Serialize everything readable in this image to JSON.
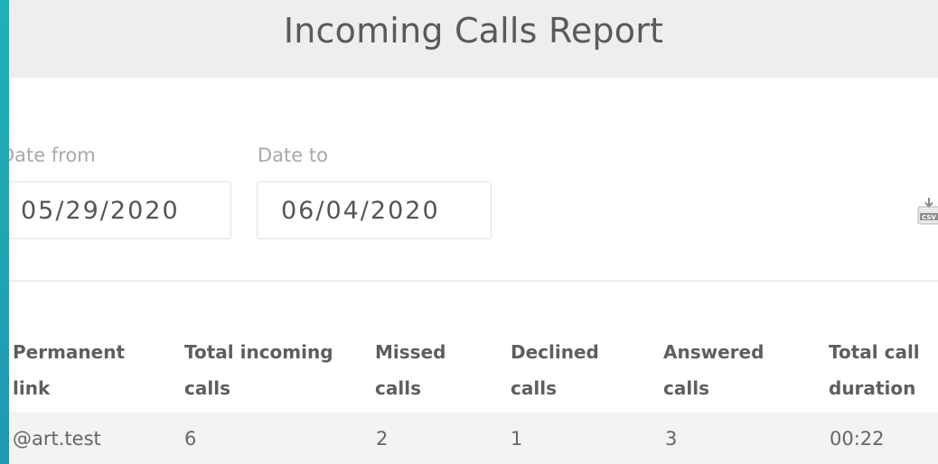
{
  "report": {
    "title": "Incoming Calls Report"
  },
  "filters": {
    "date_from_label": "Date from",
    "date_from_value": "05/29/2020",
    "date_to_label": "Date to",
    "date_to_value": "06/04/2020",
    "export_icon": "csv-download-icon"
  },
  "table": {
    "headers": [
      [
        "Permanent",
        "link"
      ],
      [
        "Total incoming",
        "calls"
      ],
      [
        "Missed",
        "calls"
      ],
      [
        "Declined",
        "calls"
      ],
      [
        "Answered",
        "calls"
      ],
      [
        "Total call",
        "duration"
      ]
    ],
    "rows": [
      [
        "@art.test",
        "6",
        "2",
        "1",
        "3",
        "00:22"
      ]
    ]
  },
  "colors": {
    "background_gradient_start": "#1fb2b6",
    "background_gradient_end": "#2a6fa0",
    "header_bg": "#eeeeee",
    "row_bg": "#f3f3f3"
  }
}
